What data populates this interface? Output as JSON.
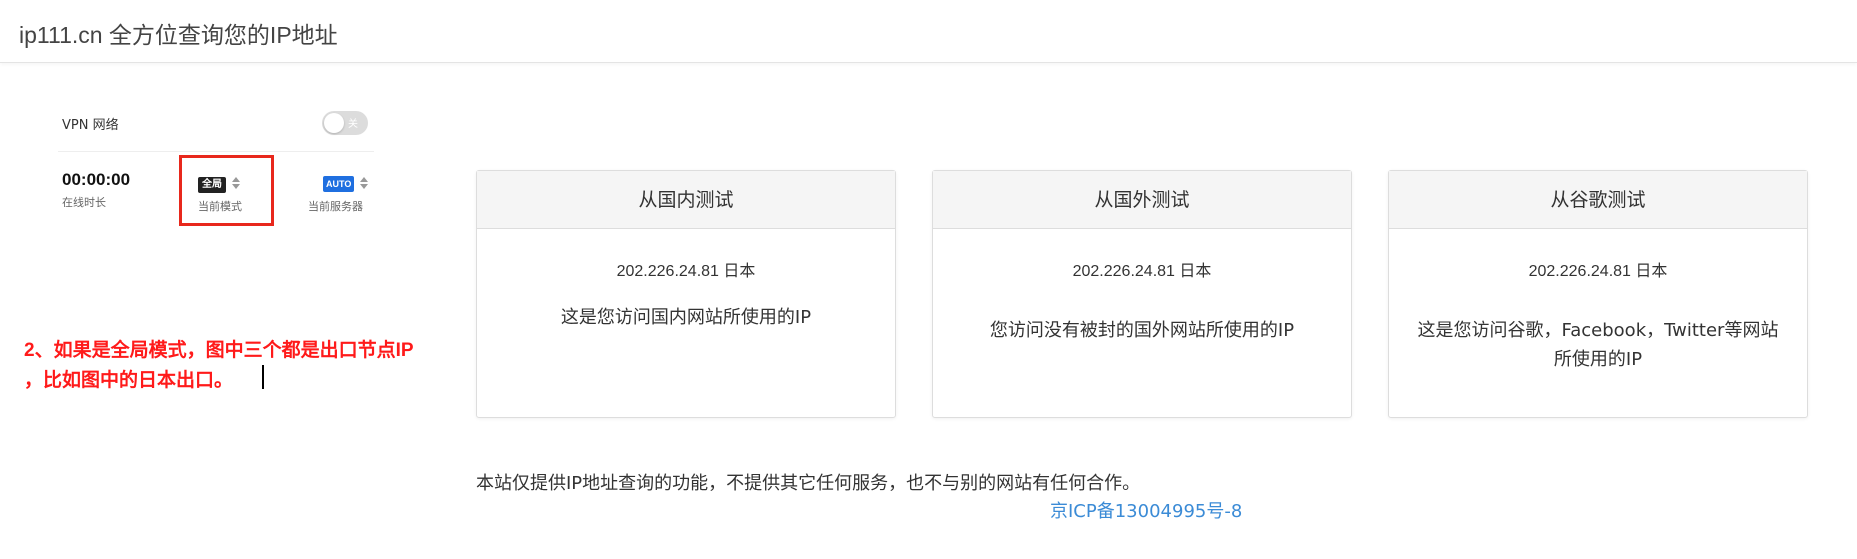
{
  "header": {
    "title": "ip111.cn 全方位查询您的IP地址"
  },
  "vpn": {
    "label": "VPN 网络",
    "toggle_text": "关",
    "timer_value": "00:00:00",
    "timer_label": "在线时长",
    "mode_chip": "全局",
    "mode_label": "当前模式",
    "server_chip": "AUTO",
    "server_label": "当前服务器"
  },
  "annotation": {
    "line1": "2、如果是全局模式，图中三个都是出口节点IP",
    "line2": "，比如图中的日本出口。"
  },
  "cards": [
    {
      "title": "从国内测试",
      "ip": "202.226.24.81 日本",
      "desc": "这是您访问国内网站所使用的IP"
    },
    {
      "title": "从国外测试",
      "ip": "202.226.24.81 日本",
      "desc": "您访问没有被封的国外网站所使用的IP"
    },
    {
      "title": "从谷歌测试",
      "ip": "202.226.24.81 日本",
      "desc": "这是您访问谷歌，Facebook，Twitter等网站所使用的IP"
    }
  ],
  "footer": {
    "notice": "本站仅提供IP地址查询的功能，不提供其它任何服务，也不与别的网站有任何合作。",
    "icp_link": "京ICP备13004995号-8"
  },
  "colors": {
    "annotation": "#ff1a1a",
    "highlight_box": "#e8281c",
    "link": "#3b8bd6",
    "server_chip": "#1f6fe0"
  }
}
